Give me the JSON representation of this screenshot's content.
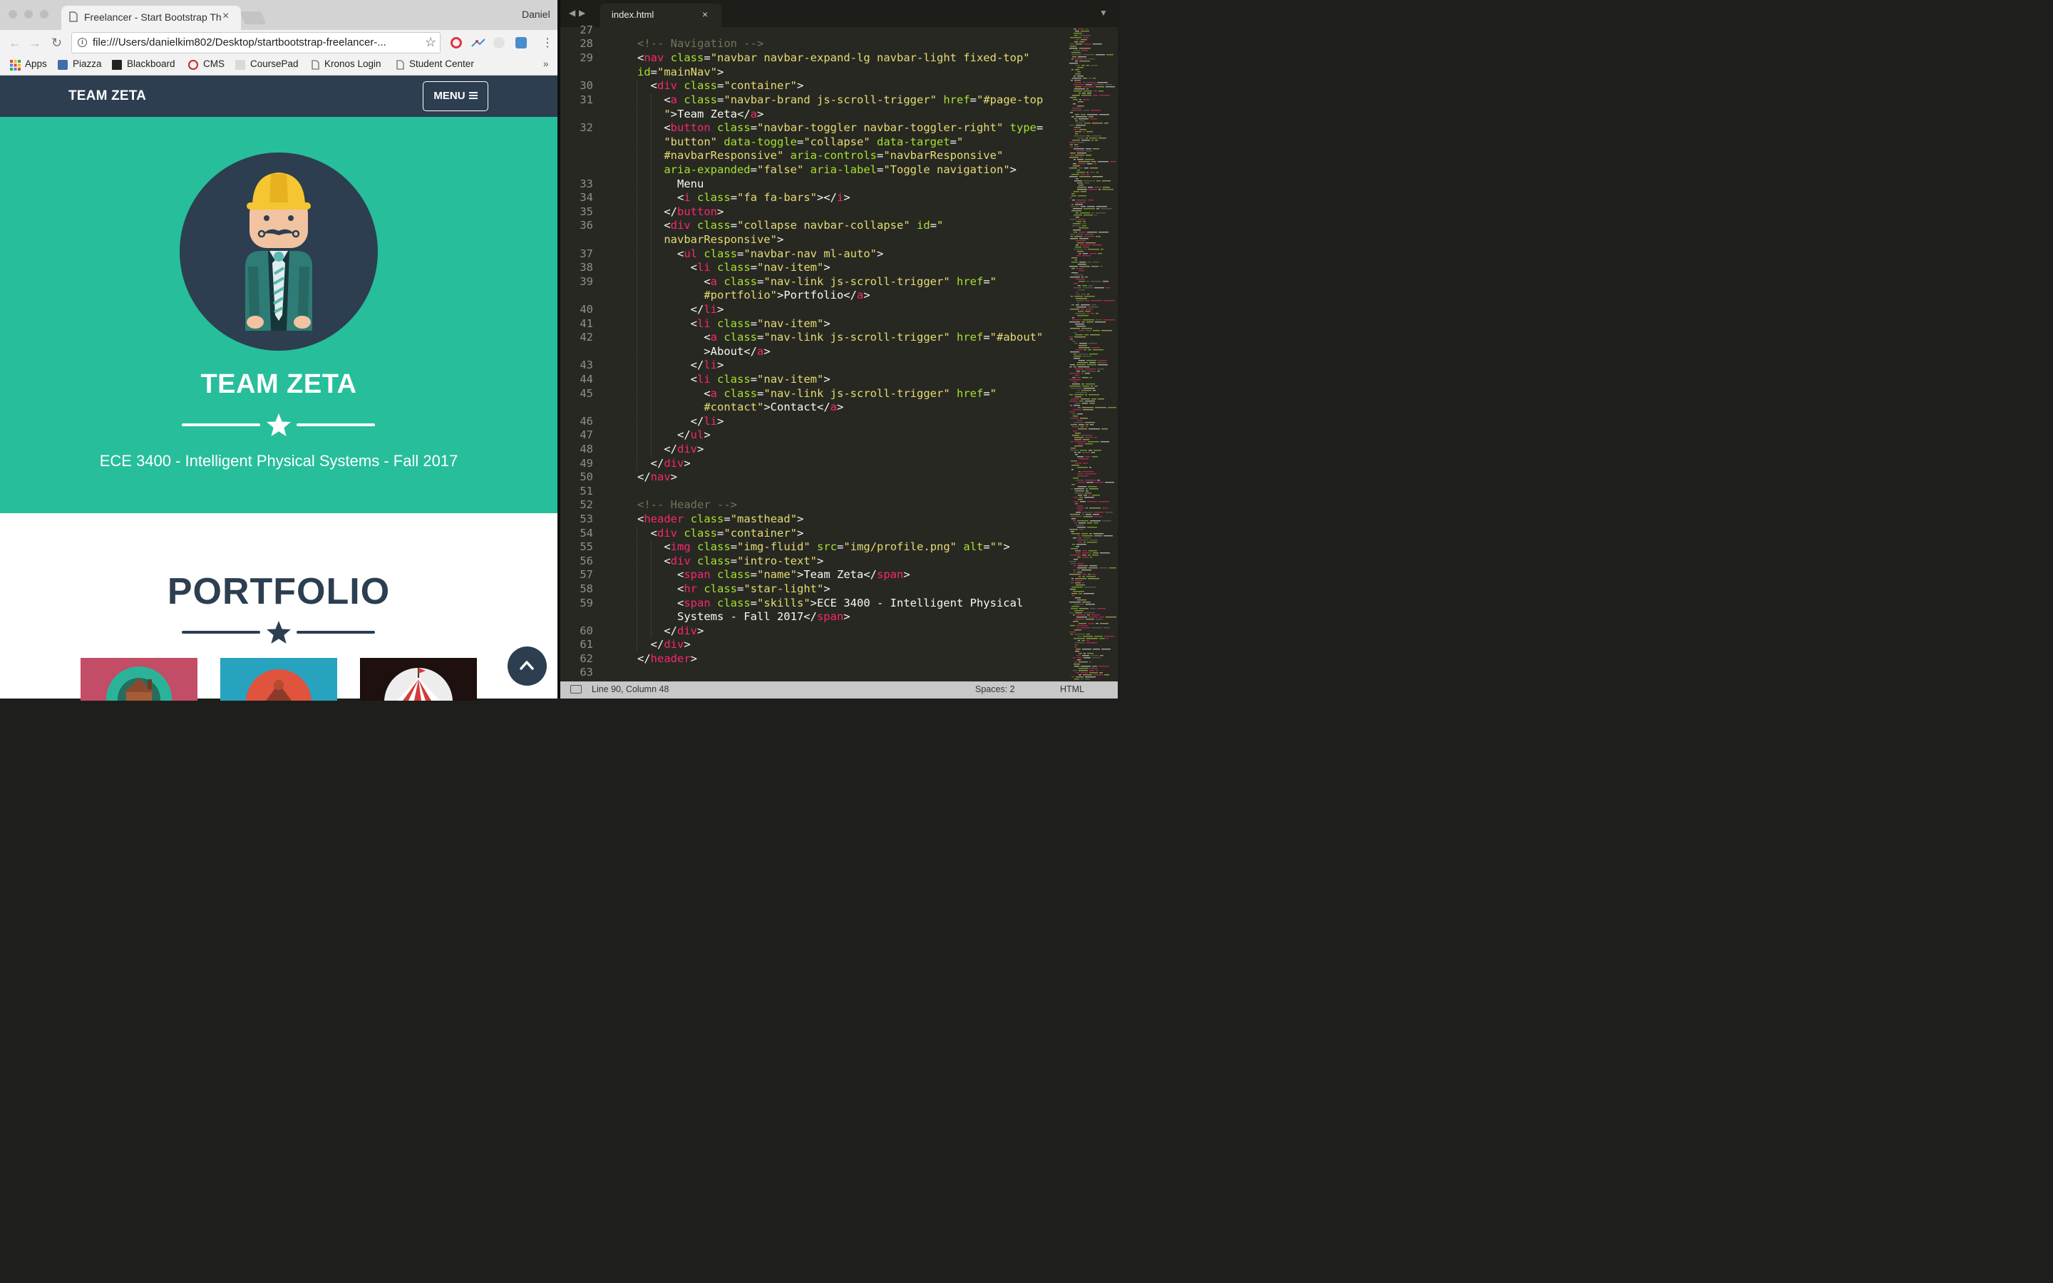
{
  "browser": {
    "tab_title": "Freelancer - Start Bootstrap Th",
    "tab_close": "×",
    "profile": "Daniel",
    "url": "file:///Users/danielkim802/Desktop/startbootstrap-freelancer-...",
    "bookmarks": [
      "Apps",
      "Piazza",
      "Blackboard",
      "CMS",
      "CoursePad",
      "Kronos Login",
      "Student Center"
    ],
    "bookmarks_overflow": "»"
  },
  "page": {
    "brand": "TEAM ZETA",
    "menu_label": "MENU",
    "name": "TEAM ZETA",
    "skills": "ECE 3400 - Intelligent Physical Systems - Fall 2017",
    "portfolio_title": "PORTFOLIO"
  },
  "editor": {
    "tab_name": "index.html",
    "tab_close": "×",
    "line_numbers": [
      "27",
      "28",
      "29",
      "",
      "30",
      "31",
      "",
      "32",
      "",
      "",
      "",
      "33",
      "34",
      "35",
      "36",
      "",
      "37",
      "38",
      "39",
      "",
      "40",
      "41",
      "42",
      "",
      "43",
      "44",
      "45",
      "",
      "46",
      "47",
      "48",
      "49",
      "50",
      "51",
      "52",
      "53",
      "54",
      "55",
      "56",
      "57",
      "58",
      "59",
      "",
      "60",
      "61",
      "62",
      "63"
    ],
    "status": {
      "position": "Line 90, Column 48",
      "spaces": "Spaces: 2",
      "syntax": "HTML"
    }
  },
  "colors": {
    "navbar": "#2c3e50",
    "masthead": "#27be9b",
    "editor_bg": "#272822",
    "tag": "#f92672",
    "attr": "#a6e22e",
    "string": "#e6db74",
    "comment": "#75715e"
  }
}
